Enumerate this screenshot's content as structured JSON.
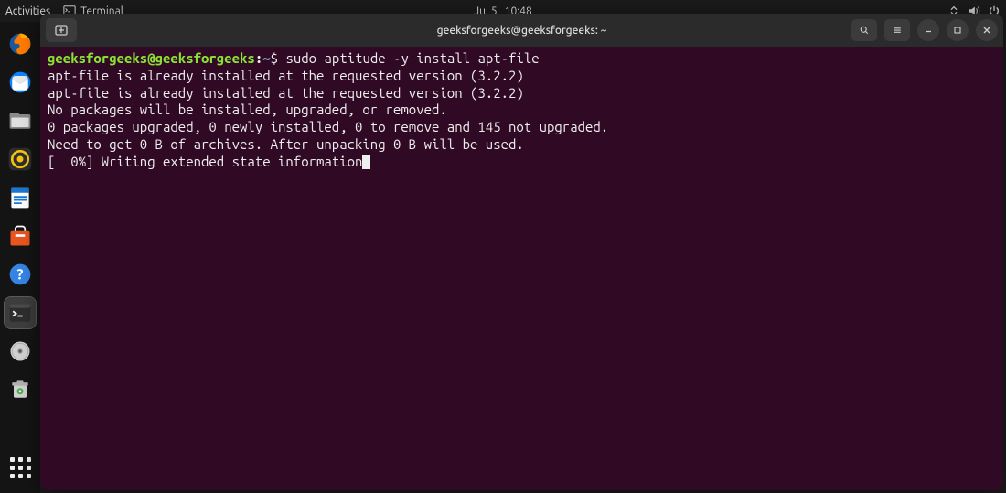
{
  "topbar": {
    "activities": "Activities",
    "terminal_label": "Terminal",
    "date": "Jul 5",
    "time": "10:48"
  },
  "window": {
    "title": "geeksforgeeks@geeksforgeeks: ~"
  },
  "terminal": {
    "prompt_user_host": "geeksforgeeks@geeksforgeeks",
    "prompt_path": "~",
    "prompt_symbol": "$",
    "command": "sudo aptitude -y install apt-file",
    "output_lines": [
      "apt-file is already installed at the requested version (3.2.2)",
      "apt-file is already installed at the requested version (3.2.2)",
      "No packages will be installed, upgraded, or removed.",
      "0 packages upgraded, 0 newly installed, 0 to remove and 145 not upgraded.",
      "Need to get 0 B of archives. After unpacking 0 B will be used.",
      "[  0%] Writing extended state information"
    ]
  },
  "dock": {
    "items": [
      "firefox",
      "thunderbird",
      "files",
      "rhythmbox",
      "writer",
      "software",
      "help",
      "terminal",
      "disc",
      "trash"
    ]
  }
}
